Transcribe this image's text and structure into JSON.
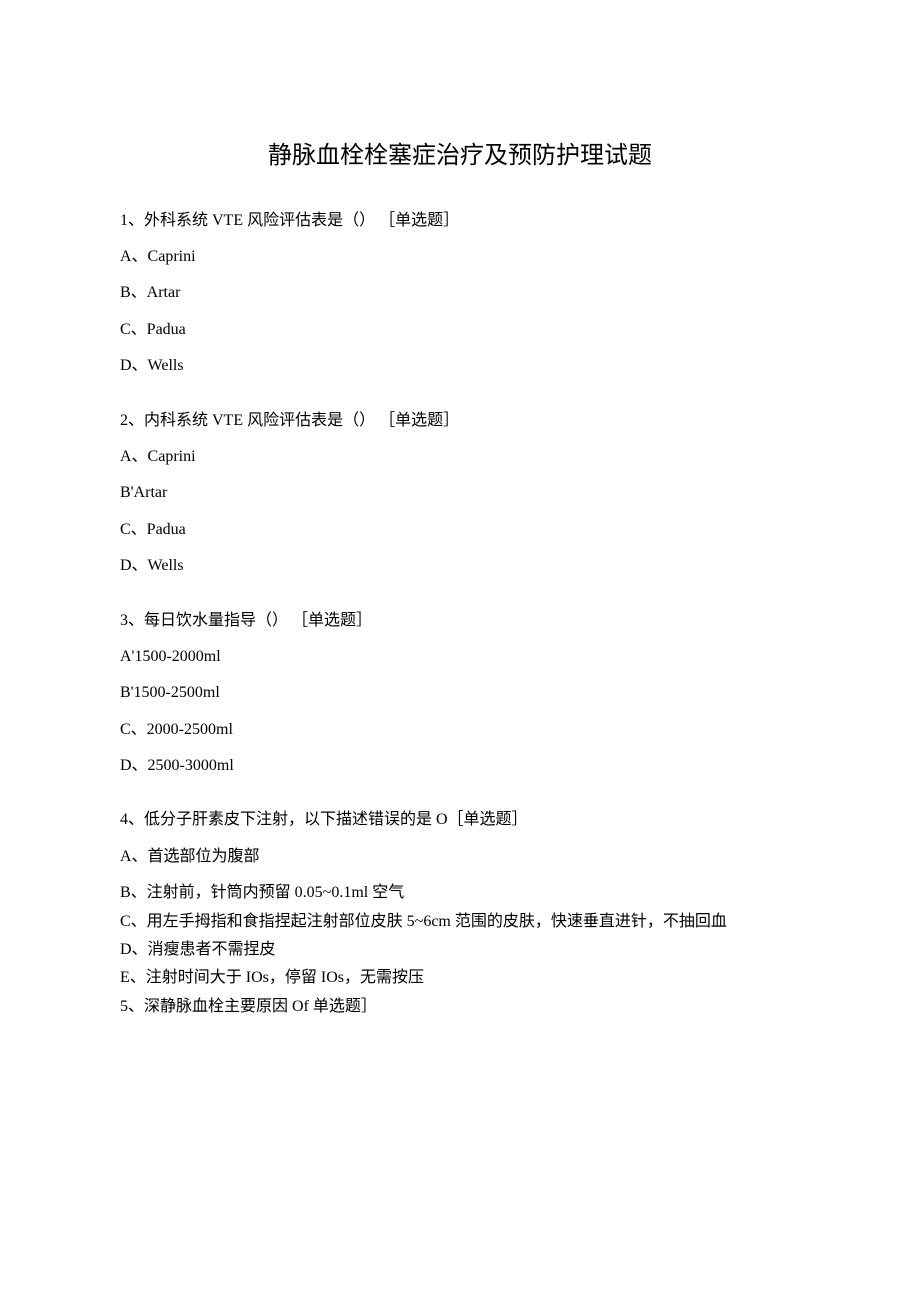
{
  "title": "静脉血栓栓塞症治疗及预防护理试题",
  "q1": {
    "text": "1、外科系统 VTE 风险评估表是（） ［单选题］",
    "a": "A、Caprini",
    "b": "B、Artar",
    "c": "C、Padua",
    "d": "D、Wells"
  },
  "q2": {
    "text": "2、内科系统 VTE 风险评估表是（） ［单选题］",
    "a": "A、Caprini",
    "b": "B'Artar",
    "c": "C、Padua",
    "d": "D、Wells"
  },
  "q3": {
    "text": "3、每日饮水量指导（） ［单选题］",
    "a": "A'1500-2000ml",
    "b": "B'1500-2500ml",
    "c": "C、2000-2500ml",
    "d": "D、2500-3000ml"
  },
  "q4": {
    "text": "4、低分子肝素皮下注射，以下描述错误的是 O［单选题］",
    "a": "A、首选部位为腹部",
    "b": "B、注射前，针筒内预留 0.05~0.1ml 空气",
    "c": "C、用左手拇指和食指捏起注射部位皮肤 5~6cm 范围的皮肤，快速垂直进针，不抽回血",
    "d": "D、消瘦患者不需捏皮",
    "e": "E、注射时间大于 IOs，停留 IOs，无需按压"
  },
  "q5": {
    "text": "5、深静脉血栓主要原因 Of 单选题］"
  }
}
